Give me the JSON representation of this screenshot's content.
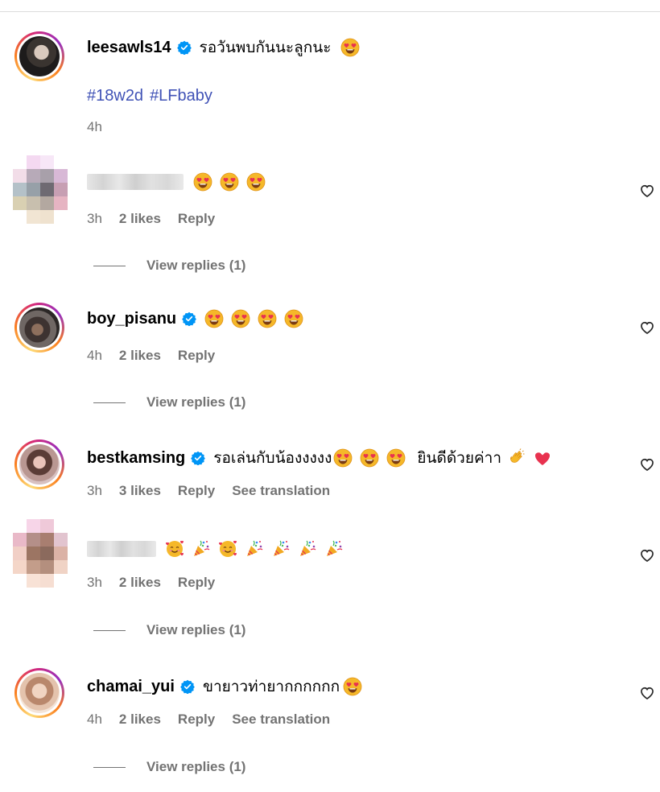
{
  "comments": [
    {
      "username": "leesawls14",
      "verified": true,
      "text": "รอวันพบกันนะลูกนะ",
      "emojis": [
        "heart-eyes-emoji"
      ],
      "hashtags": [
        "#18w2d",
        "#LFbaby"
      ],
      "time": "4h"
    },
    {
      "username": "",
      "blurred": true,
      "emojis": [
        "heart-eyes-emoji",
        "heart-eyes-emoji",
        "heart-eyes-emoji"
      ],
      "time": "3h",
      "likes": "2 likes",
      "reply": "Reply",
      "view_replies": "View replies (1)"
    },
    {
      "username": "boy_pisanu",
      "verified": true,
      "emojis": [
        "heart-eyes-emoji",
        "heart-eyes-emoji",
        "heart-eyes-emoji",
        "heart-eyes-emoji"
      ],
      "time": "4h",
      "likes": "2 likes",
      "reply": "Reply",
      "view_replies": "View replies (1)"
    },
    {
      "username": "bestkamsing",
      "verified": true,
      "text": "รอเล่นกับน้องงงงง",
      "text2": "ยินดีด้วยค่าา",
      "emojis": [
        "heart-eyes-emoji",
        "heart-eyes-emoji",
        "heart-eyes-emoji",
        "clapping-hands-emoji",
        "red-heart-emoji"
      ],
      "time": "3h",
      "likes": "3 likes",
      "reply": "Reply",
      "see_translation": "See translation"
    },
    {
      "username": "",
      "blurred": true,
      "emojis": [
        "smiling-face-with-hearts-emoji",
        "party-popper-emoji",
        "smiling-face-with-hearts-emoji",
        "party-popper-emoji",
        "party-popper-emoji",
        "party-popper-emoji",
        "party-popper-emoji"
      ],
      "time": "3h",
      "likes": "2 likes",
      "reply": "Reply",
      "view_replies": "View replies (1)"
    },
    {
      "username": "chamai_yui",
      "verified": true,
      "text": "ขายาวท่ายากกกกกก",
      "emojis": [
        "heart-eyes-emoji"
      ],
      "time": "4h",
      "likes": "2 likes",
      "reply": "Reply",
      "see_translation": "See translation",
      "view_replies": "View replies (1)"
    }
  ],
  "colors": {
    "hashtag": "#4052b6",
    "verified": "#0095f6",
    "muted": "#737373",
    "ring_start": "#feda75",
    "ring_end": "#d62976"
  }
}
